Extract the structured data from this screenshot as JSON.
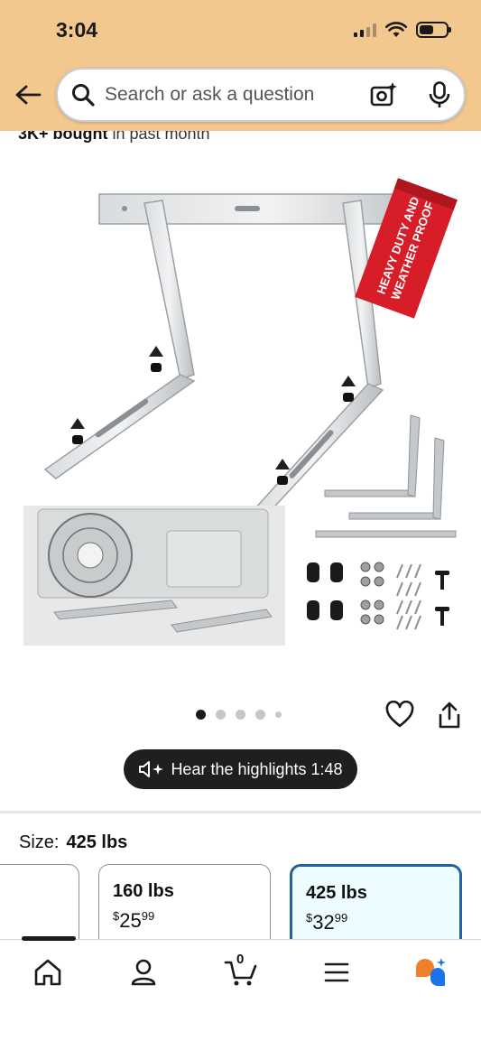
{
  "status_bar": {
    "time": "3:04"
  },
  "search": {
    "placeholder": "Search or ask a question"
  },
  "social_proof": {
    "bold": "3K+ bought",
    "rest": " in past month"
  },
  "product_image": {
    "banner_text_1": "HEAVY DUTY AND",
    "banner_text_2": "WEATHER PROOF"
  },
  "carousel": {
    "count": 5,
    "active": 1
  },
  "highlights": {
    "label": "Hear the highlights 1:48"
  },
  "size": {
    "label": "Size:",
    "selected": "425 lbs",
    "options": [
      {
        "weight": "160 lbs",
        "symbol": "$",
        "dollars": "25",
        "cents": "99"
      },
      {
        "weight": "425 lbs",
        "symbol": "$",
        "dollars": "32",
        "cents": "99"
      }
    ]
  },
  "nav": {
    "cart_count": "0"
  },
  "colors": {
    "header": "#f2c88f",
    "selected_border": "#2162a1",
    "selected_bg": "#edfdff",
    "banner_red": "#d71e28"
  },
  "icons": [
    "back-arrow-icon",
    "search-icon",
    "camera-sparkle-icon",
    "microphone-icon",
    "heart-icon",
    "share-icon",
    "speaker-sparkle-icon",
    "home-icon",
    "account-icon",
    "cart-icon",
    "menu-icon",
    "rufus-icon"
  ]
}
